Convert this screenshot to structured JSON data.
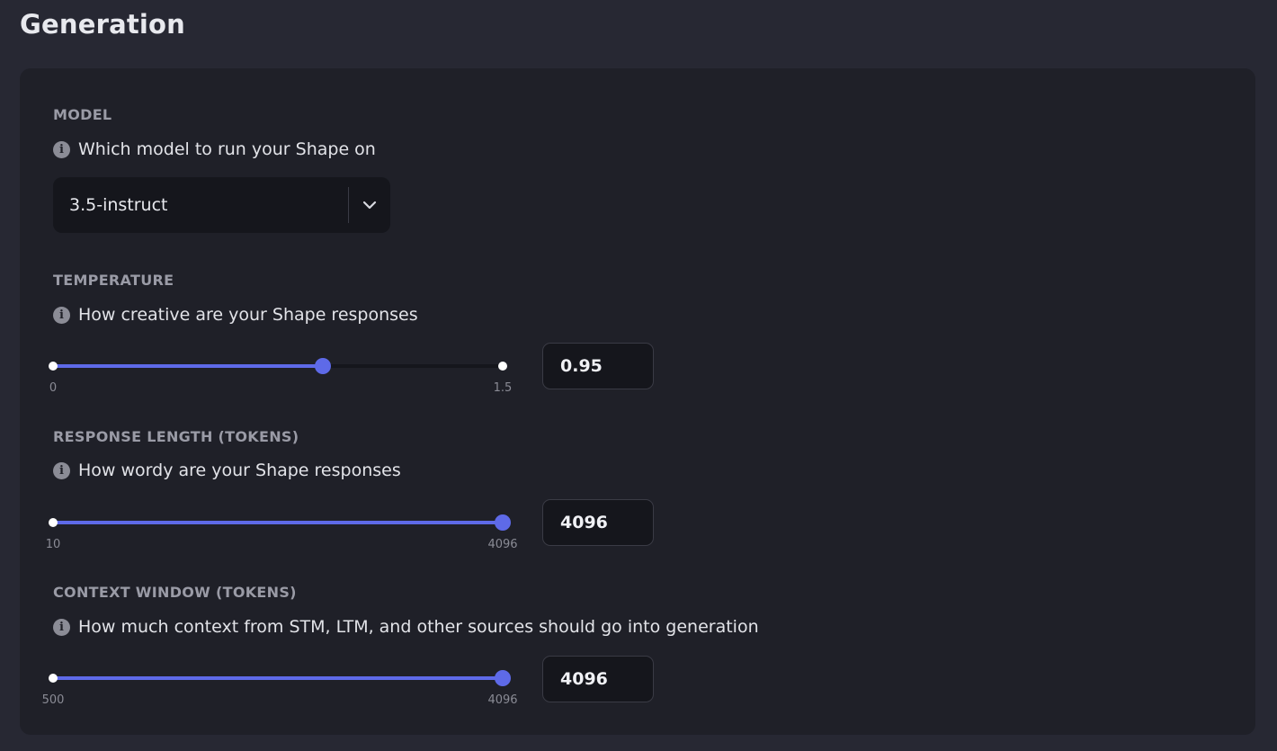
{
  "page": {
    "title": "Generation"
  },
  "icons": {
    "info": "info-icon",
    "chevron": "chevron-down-icon"
  },
  "colors": {
    "accent": "#5e6ae8",
    "background": "#272833",
    "card": "#1f2028",
    "input": "#15161c"
  },
  "model": {
    "label": "MODEL",
    "description": "Which model to run your Shape on",
    "selected": "3.5-instruct"
  },
  "temperature": {
    "label": "TEMPERATURE",
    "description": "How creative are your Shape responses",
    "min": "0",
    "max": "1.5",
    "value": "0.95",
    "fraction": 0.6
  },
  "response_length": {
    "label": "RESPONSE LENGTH (TOKENS)",
    "description": "How wordy are your Shape responses",
    "min": "10",
    "max": "4096",
    "value": "4096",
    "fraction": 1.0
  },
  "context_window": {
    "label": "CONTEXT WINDOW (TOKENS)",
    "description": "How much context from STM, LTM, and other sources should go into generation",
    "min": "500",
    "max": "4096",
    "value": "4096",
    "fraction": 1.0
  }
}
